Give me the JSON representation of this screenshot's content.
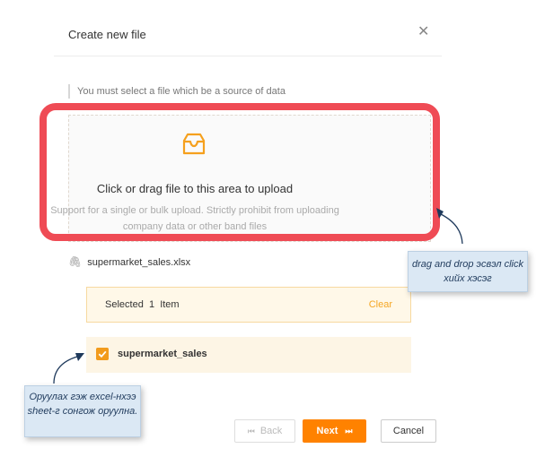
{
  "dialog": {
    "title": "Create new file",
    "close_icon": "close-icon",
    "hint": "You must select a file which be a source of data"
  },
  "upload": {
    "icon": "inbox-icon",
    "main_text": "Click or drag file to this area to upload",
    "sub_text": "Support for a single or bulk upload. Strictly prohibit from uploading company data or other band files"
  },
  "file": {
    "icon": "paperclip-icon",
    "name": "supermarket_sales.xlsx"
  },
  "selection": {
    "label": "Selected",
    "count": "1",
    "unit": "Item",
    "clear_label": "Clear"
  },
  "sheets": [
    {
      "name": "supermarket_sales",
      "checked": true
    }
  ],
  "footer": {
    "back_label": "Back",
    "next_label": "Next",
    "cancel_label": "Cancel"
  },
  "annotations": {
    "drag_callout": "drag and drop эсвэл click хийх хэсэг",
    "sheet_callout": "Оруулах гэж excel-нхээ sheet-г сонгож оруулна."
  },
  "colors": {
    "accent": "#ff8200",
    "highlight": "#ef4b55",
    "callout_bg": "#dbe8f4"
  }
}
